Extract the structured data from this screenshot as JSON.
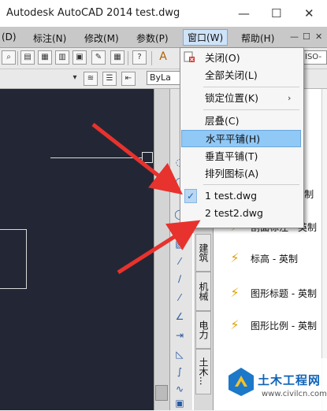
{
  "window": {
    "app_title": "Autodesk AutoCAD 2014",
    "file_title": "test.dwg",
    "controls": [
      "—",
      "☐",
      "✕"
    ]
  },
  "menubar": {
    "items": [
      "(D)",
      "标注(N)",
      "修改(M)",
      "参数(P)",
      "窗口(W)",
      "帮助(H)"
    ],
    "right_controls": [
      "—",
      "☐",
      "✕"
    ]
  },
  "toolbar2": {
    "layer_combo": "ByLa",
    "right_combo": "ISO-"
  },
  "window_menu": {
    "items": [
      {
        "label": "关闭(O)",
        "key": "O"
      },
      {
        "label": "全部关闭(L)",
        "key": "L"
      },
      {
        "label": "锁定位置(K)",
        "key": "K",
        "submenu": true
      },
      {
        "label": "层叠(C)",
        "key": "C"
      },
      {
        "label": "水平平铺(H)",
        "key": "H",
        "highlighted": true
      },
      {
        "label": "垂直平铺(T)",
        "key": "T"
      },
      {
        "label": "排列图标(A)",
        "key": "A"
      },
      {
        "label": "1 test.dwg",
        "checked": true
      },
      {
        "label": "2 test2.dwg"
      }
    ],
    "submenu_arrow": "›",
    "check_mark": "✓"
  },
  "palette": {
    "tabs": [
      "建筑",
      "机械",
      "电力",
      "土木..."
    ],
    "partial_label": "- 英制",
    "items": [
      {
        "label": "剖面标注 - 英制",
        "icon": "section-callout-icon"
      },
      {
        "label": "标高 - 英制",
        "icon": "elevation-icon"
      },
      {
        "label": "图形标题 - 英制",
        "icon": "drawing-title-icon"
      },
      {
        "label": "图形比例 - 英制",
        "icon": "drawing-scale-icon"
      }
    ]
  },
  "watermark": {
    "title": "土木工程网",
    "url": "www.civilcn.com"
  },
  "colors": {
    "canvas": "#232735",
    "arrow": "#e8322d",
    "highlight": "#90c8f6",
    "brand": "#0f63b8"
  }
}
